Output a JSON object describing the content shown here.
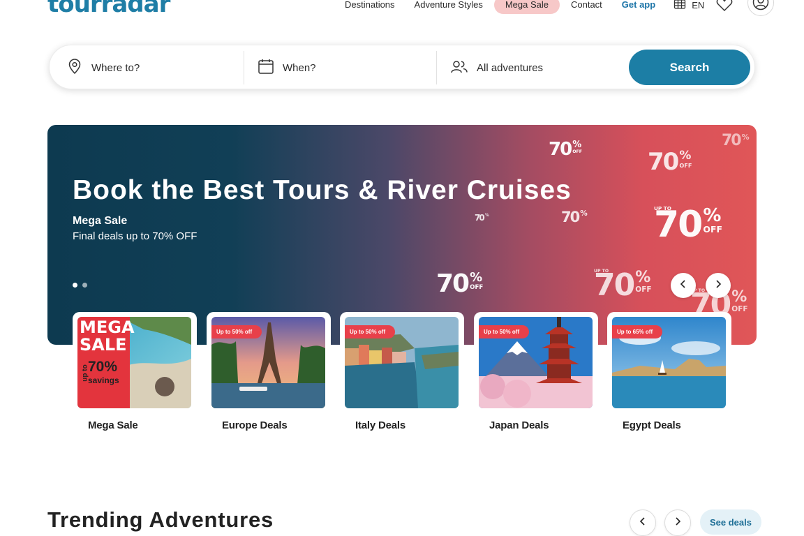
{
  "brand": {
    "logo": "tourradar",
    "color": "#1f7ea6"
  },
  "nav": {
    "items": [
      "Destinations",
      "Adventure Styles",
      "Mega Sale",
      "Contact",
      "Get app"
    ],
    "language": "EN",
    "icons": [
      "globe-icon",
      "heart-icon",
      "user-icon"
    ]
  },
  "search": {
    "where_label": "Where to?",
    "when_label": "When?",
    "who_label": "All adventures",
    "button_label": "Search",
    "button_color": "#1c7ea5"
  },
  "hero": {
    "title": "Book the Best Tours & River Cruises",
    "subtitle": "Mega Sale",
    "text": "Final deals up to 70% OFF",
    "promo": {
      "upto": "UP TO",
      "value": "70",
      "pct": "%",
      "off": "OFF"
    },
    "colors": [
      "#0d3a50",
      "#e05658"
    ]
  },
  "deals": [
    {
      "label": "Mega Sale",
      "badge": "",
      "mega": "MEGA",
      "sale": "SALE",
      "upto": "up to",
      "percent": "70%",
      "savings": "savings"
    },
    {
      "label": "Europe Deals",
      "badge": "Up to 50% off"
    },
    {
      "label": "Italy Deals",
      "badge": "Up to 50% off"
    },
    {
      "label": "Japan Deals",
      "badge": "Up to 50% off"
    },
    {
      "label": "Egypt Deals",
      "badge": "Up to 65% off"
    }
  ],
  "trending": {
    "title": "Trending Adventures",
    "see_deals": "See deals"
  }
}
